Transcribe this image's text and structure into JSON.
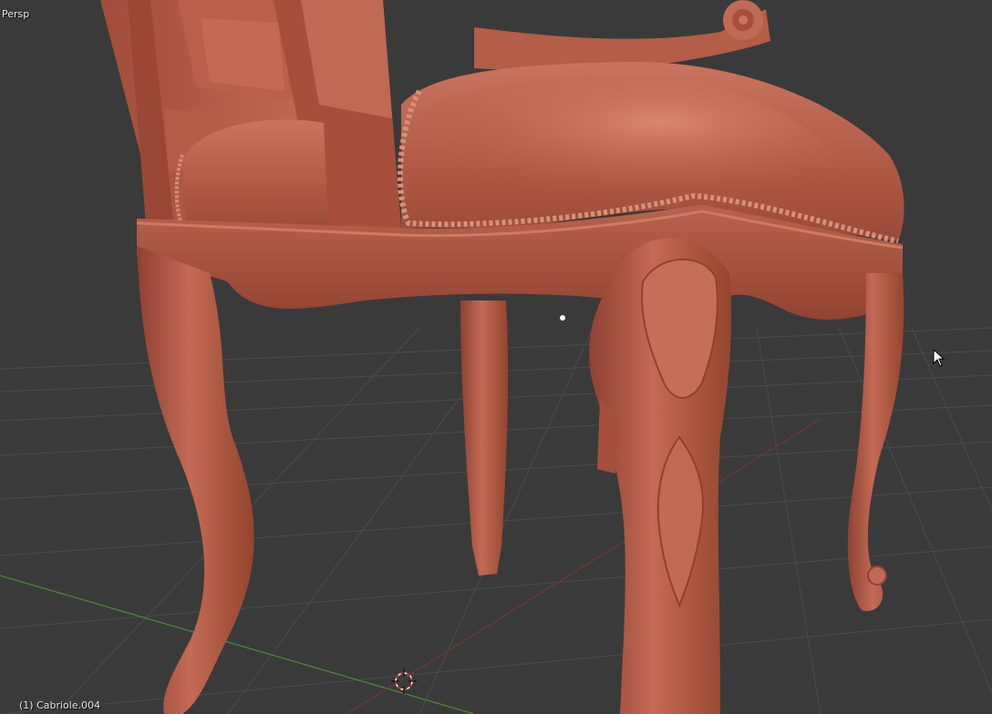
{
  "viewport": {
    "view_label": "Persp",
    "object_label": "(1) Cabriole.004",
    "background_color": "#3a3a3a",
    "grid_color": "#4a4a4a",
    "x_axis_color": "#a33a3a",
    "y_axis_color": "#4f8a3a",
    "model_color": "#b45a48"
  },
  "icons": {
    "origin": "3d-cursor-icon",
    "pointer": "mouse-pointer-icon",
    "object_origin": "origin-dot-icon"
  }
}
